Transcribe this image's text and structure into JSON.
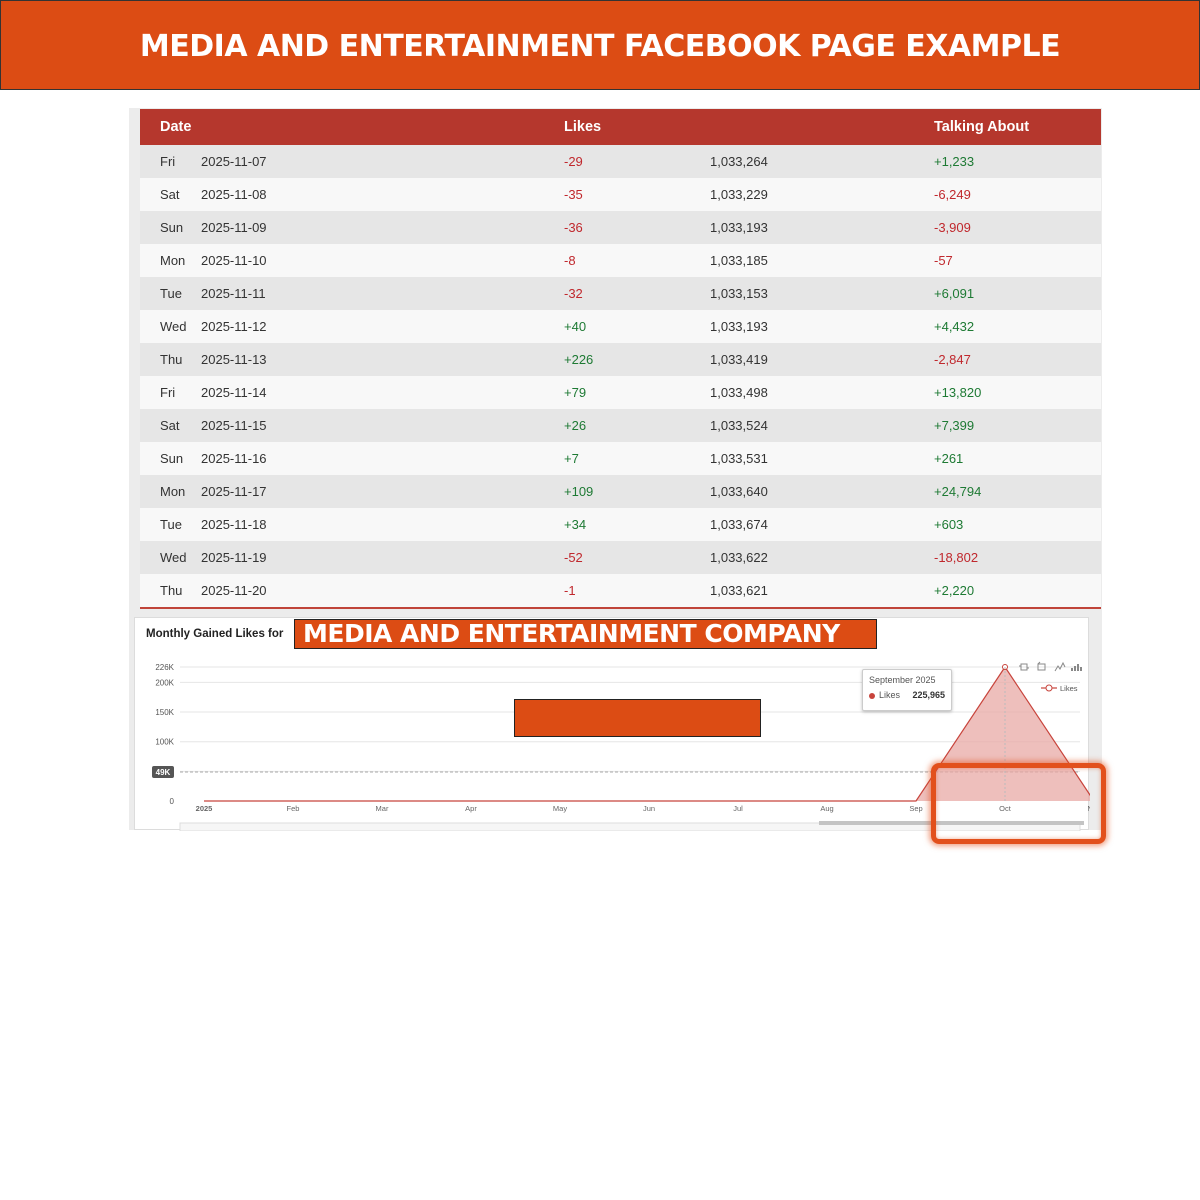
{
  "banner": {
    "title": "MEDIA AND ENTERTAINMENT FACEBOOK PAGE EXAMPLE"
  },
  "table": {
    "headers": {
      "date": "Date",
      "likes": "Likes",
      "talking": "Talking About"
    },
    "rows": [
      {
        "day": "Fri",
        "date": "2025-11-07",
        "likes_change": "-29",
        "likes_total": "1,033,264",
        "talking": "+1,233"
      },
      {
        "day": "Sat",
        "date": "2025-11-08",
        "likes_change": "-35",
        "likes_total": "1,033,229",
        "talking": "-6,249"
      },
      {
        "day": "Sun",
        "date": "2025-11-09",
        "likes_change": "-36",
        "likes_total": "1,033,193",
        "talking": "-3,909"
      },
      {
        "day": "Mon",
        "date": "2025-11-10",
        "likes_change": "-8",
        "likes_total": "1,033,185",
        "talking": "-57"
      },
      {
        "day": "Tue",
        "date": "2025-11-11",
        "likes_change": "-32",
        "likes_total": "1,033,153",
        "talking": "+6,091"
      },
      {
        "day": "Wed",
        "date": "2025-11-12",
        "likes_change": "+40",
        "likes_total": "1,033,193",
        "talking": "+4,432"
      },
      {
        "day": "Thu",
        "date": "2025-11-13",
        "likes_change": "+226",
        "likes_total": "1,033,419",
        "talking": "-2,847"
      },
      {
        "day": "Fri",
        "date": "2025-11-14",
        "likes_change": "+79",
        "likes_total": "1,033,498",
        "talking": "+13,820"
      },
      {
        "day": "Sat",
        "date": "2025-11-15",
        "likes_change": "+26",
        "likes_total": "1,033,524",
        "talking": "+7,399"
      },
      {
        "day": "Sun",
        "date": "2025-11-16",
        "likes_change": "+7",
        "likes_total": "1,033,531",
        "talking": "+261"
      },
      {
        "day": "Mon",
        "date": "2025-11-17",
        "likes_change": "+109",
        "likes_total": "1,033,640",
        "talking": "+24,794"
      },
      {
        "day": "Tue",
        "date": "2025-11-18",
        "likes_change": "+34",
        "likes_total": "1,033,674",
        "talking": "+603"
      },
      {
        "day": "Wed",
        "date": "2025-11-19",
        "likes_change": "-52",
        "likes_total": "1,033,622",
        "talking": "-18,802"
      },
      {
        "day": "Thu",
        "date": "2025-11-20",
        "likes_change": "-1",
        "likes_total": "1,033,621",
        "talking": "+2,220"
      }
    ]
  },
  "chart": {
    "title": "Monthly Gained Likes for",
    "overlay_label": "MEDIA AND ENTERTAINMENT COMPANY",
    "legend": "Likes",
    "toolbar_icons": [
      "zoom-icon",
      "zoom-reset-icon",
      "line-chart-icon",
      "bar-chart-icon"
    ],
    "marker_label": "49K",
    "tooltip": {
      "date": "September 2025",
      "series": "Likes",
      "value": "225,965"
    },
    "colors": {
      "line": "#C8443C",
      "area": "#E8A9A5",
      "accent": "#DC4C14"
    }
  },
  "chart_data": {
    "type": "area",
    "x": [
      "2025",
      "Feb",
      "Mar",
      "Apr",
      "May",
      "Jun",
      "Jul",
      "Aug",
      "Sep",
      "Oct",
      "Nov"
    ],
    "series": [
      {
        "name": "Likes",
        "values": [
          0,
          0,
          0,
          0,
          0,
          0,
          0,
          0,
          0,
          225965,
          0
        ]
      }
    ],
    "y_ticks": [
      "0",
      "50K",
      "100K",
      "150K",
      "200K",
      "226K"
    ],
    "ylim": [
      0,
      226000
    ],
    "reference_line": 49000,
    "legend_position": "top-right",
    "grid": true
  }
}
